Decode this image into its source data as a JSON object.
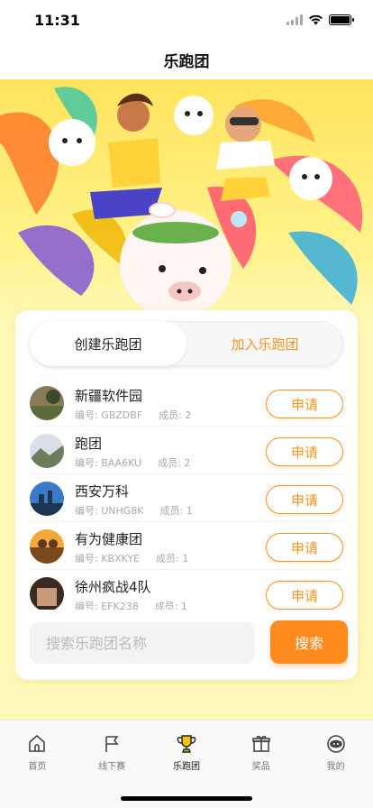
{
  "status": {
    "time": "11:31"
  },
  "nav": {
    "title": "乐跑团"
  },
  "tabs": [
    {
      "label": "创建乐跑团",
      "active": true
    },
    {
      "label": "加入乐跑团",
      "active": false
    }
  ],
  "teams": [
    {
      "name": "新疆软件园",
      "code": "编号: GBZDBF",
      "members": "成员: 2",
      "action": "申请"
    },
    {
      "name": "跑团",
      "code": "编号: BAA6KU",
      "members": "成员: 2",
      "action": "申请"
    },
    {
      "name": "西安万科",
      "code": "编号: UNHG8K",
      "members": "成员: 1",
      "action": "申请"
    },
    {
      "name": "有为健康团",
      "code": "编号: KBXKYE",
      "members": "成员: 1",
      "action": "申请"
    },
    {
      "name": "徐州疯战4队",
      "code": "编号: EFK238",
      "members": "成员: 1",
      "action": "申请"
    }
  ],
  "search": {
    "placeholder": "搜索乐跑团名称",
    "value": "",
    "button": "搜索"
  },
  "tabbar": [
    {
      "label": "首页",
      "icon": "home-icon"
    },
    {
      "label": "线下赛",
      "icon": "flag-icon"
    },
    {
      "label": "乐跑团",
      "icon": "trophy-icon",
      "active": true
    },
    {
      "label": "奖品",
      "icon": "gift-icon"
    },
    {
      "label": "我的",
      "icon": "profile-icon"
    }
  ],
  "colors": {
    "accent": "#f7931e",
    "button": "#ff8a1e",
    "background": "#fff8b8"
  }
}
